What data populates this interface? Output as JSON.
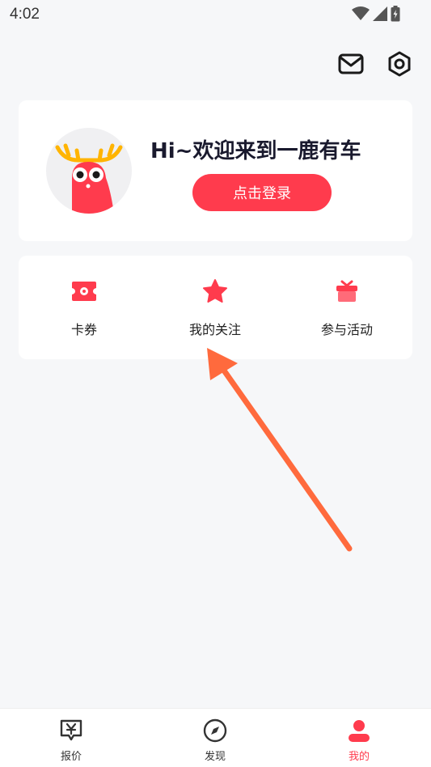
{
  "status_bar": {
    "time": "4:02",
    "icons": [
      "wifi-icon",
      "signal-icon",
      "battery-icon"
    ]
  },
  "top_actions": {
    "icons": [
      "mail-icon",
      "settings-icon"
    ]
  },
  "profile": {
    "welcome": "Hi~欢迎来到一鹿有车",
    "login_label": "点击登录"
  },
  "menu": {
    "items": [
      {
        "label": "卡券",
        "icon": "coupon-icon"
      },
      {
        "label": "我的关注",
        "icon": "star-icon"
      },
      {
        "label": "参与活动",
        "icon": "gift-icon"
      }
    ]
  },
  "bottom_nav": {
    "items": [
      {
        "label": "报价",
        "icon": "price-tag-icon",
        "active": false
      },
      {
        "label": "发现",
        "icon": "compass-icon",
        "active": false
      },
      {
        "label": "我的",
        "icon": "user-icon",
        "active": true
      }
    ]
  },
  "colors": {
    "accent": "#ff3b4d",
    "background": "#f6f7f9",
    "annotation_arrow": "#ff6a3d"
  }
}
